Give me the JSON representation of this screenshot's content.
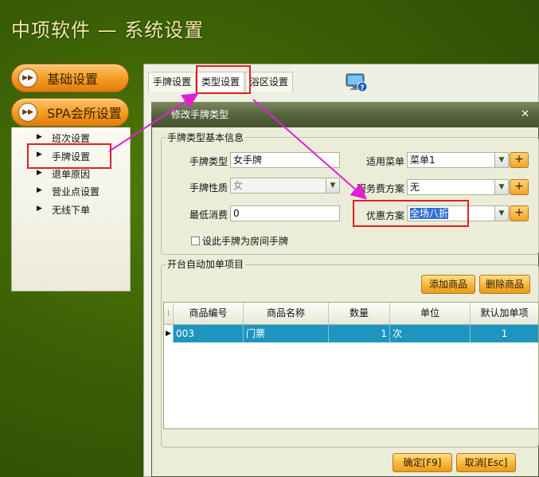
{
  "app": {
    "title": "中项软件 — 系统设置"
  },
  "nav": {
    "basic": "基础设置",
    "spa": "SPA会所设置",
    "sub_items": [
      {
        "label": "班次设置"
      },
      {
        "label": "手牌设置"
      },
      {
        "label": "退单原因"
      },
      {
        "label": "营业点设置"
      },
      {
        "label": "无线下单"
      }
    ]
  },
  "tabs": [
    {
      "label": "手牌设置"
    },
    {
      "label": "类型设置"
    },
    {
      "label": "浴区设置"
    }
  ],
  "dialog": {
    "title": "修改手牌类型",
    "basic_group": "手牌类型基本信息",
    "type_label": "手牌类型",
    "type_value": "女手牌",
    "nature_label": "手牌性质",
    "nature_value": "女",
    "min_label": "最低消费",
    "min_value": "0",
    "menu_label": "适用菜单",
    "menu_value": "菜单1",
    "service_label": "服务费方案",
    "service_value": "无",
    "discount_label": "优惠方案",
    "discount_value": "全场八折",
    "room_checkbox": "设此手牌为房间手牌",
    "auto_group": "开台自动加单项目",
    "add_btn": "添加商品",
    "del_btn": "删除商品",
    "columns": [
      "商品编号",
      "商品名称",
      "数量",
      "单位",
      "默认加单项"
    ],
    "rows": [
      {
        "code": "003",
        "name": "门票",
        "qty": "1",
        "unit": "次",
        "default": "1"
      }
    ],
    "ok_btn": "确定[F9]",
    "cancel_btn": "取消[Esc]"
  },
  "colors": {
    "accent_orange": "#f39a1e",
    "grid_select": "#1e95c0",
    "highlight_red": "#e02020",
    "arrow_magenta": "#e020d8"
  }
}
